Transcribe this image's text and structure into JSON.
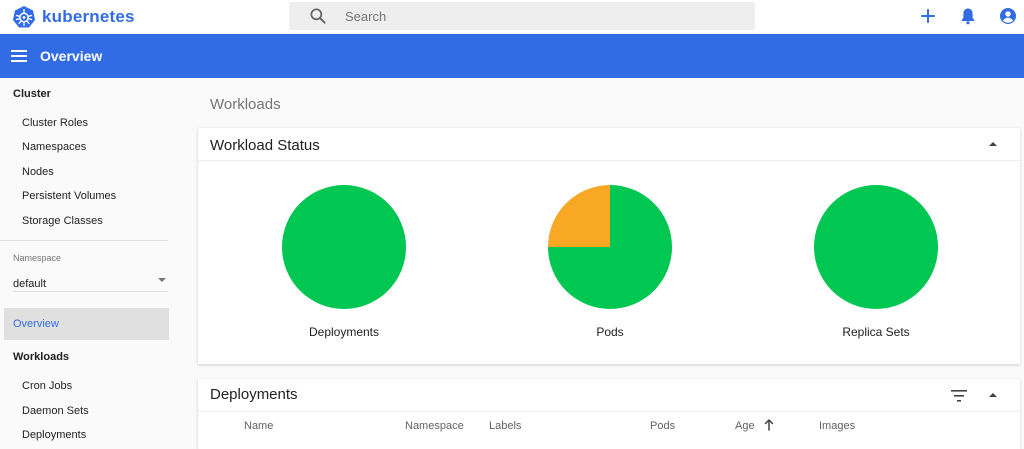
{
  "topbar": {
    "brand": "kubernetes",
    "search": {
      "placeholder": "Search"
    },
    "icons": [
      "add-icon",
      "notifications-icon",
      "account-icon"
    ]
  },
  "appbar": {
    "title": "Overview"
  },
  "sidebar": {
    "cluster_section": "Cluster",
    "cluster_items": [
      {
        "label": "Cluster Roles"
      },
      {
        "label": "Namespaces"
      },
      {
        "label": "Nodes"
      },
      {
        "label": "Persistent Volumes"
      },
      {
        "label": "Storage Classes"
      }
    ],
    "namespace_label": "Namespace",
    "namespace_value": "default",
    "active_item": "Overview",
    "workloads_section": "Workloads",
    "workload_items": [
      {
        "label": "Cron Jobs"
      },
      {
        "label": "Daemon Sets"
      },
      {
        "label": "Deployments"
      }
    ]
  },
  "main": {
    "heading": "Workloads",
    "workload_status": {
      "title": "Workload Status",
      "charts": [
        {
          "label": "Deployments",
          "running": 1.0,
          "pending": 0.0
        },
        {
          "label": "Pods",
          "running": 0.75,
          "pending": 0.25
        },
        {
          "label": "Replica Sets",
          "running": 1.0,
          "pending": 0.0
        }
      ]
    },
    "deployments": {
      "title": "Deployments",
      "columns": [
        "Name",
        "Namespace",
        "Labels",
        "Pods",
        "Age",
        "Images"
      ]
    }
  },
  "colors": {
    "primary": "#326ce5",
    "running": "#00c752",
    "pending": "#f9a825"
  }
}
